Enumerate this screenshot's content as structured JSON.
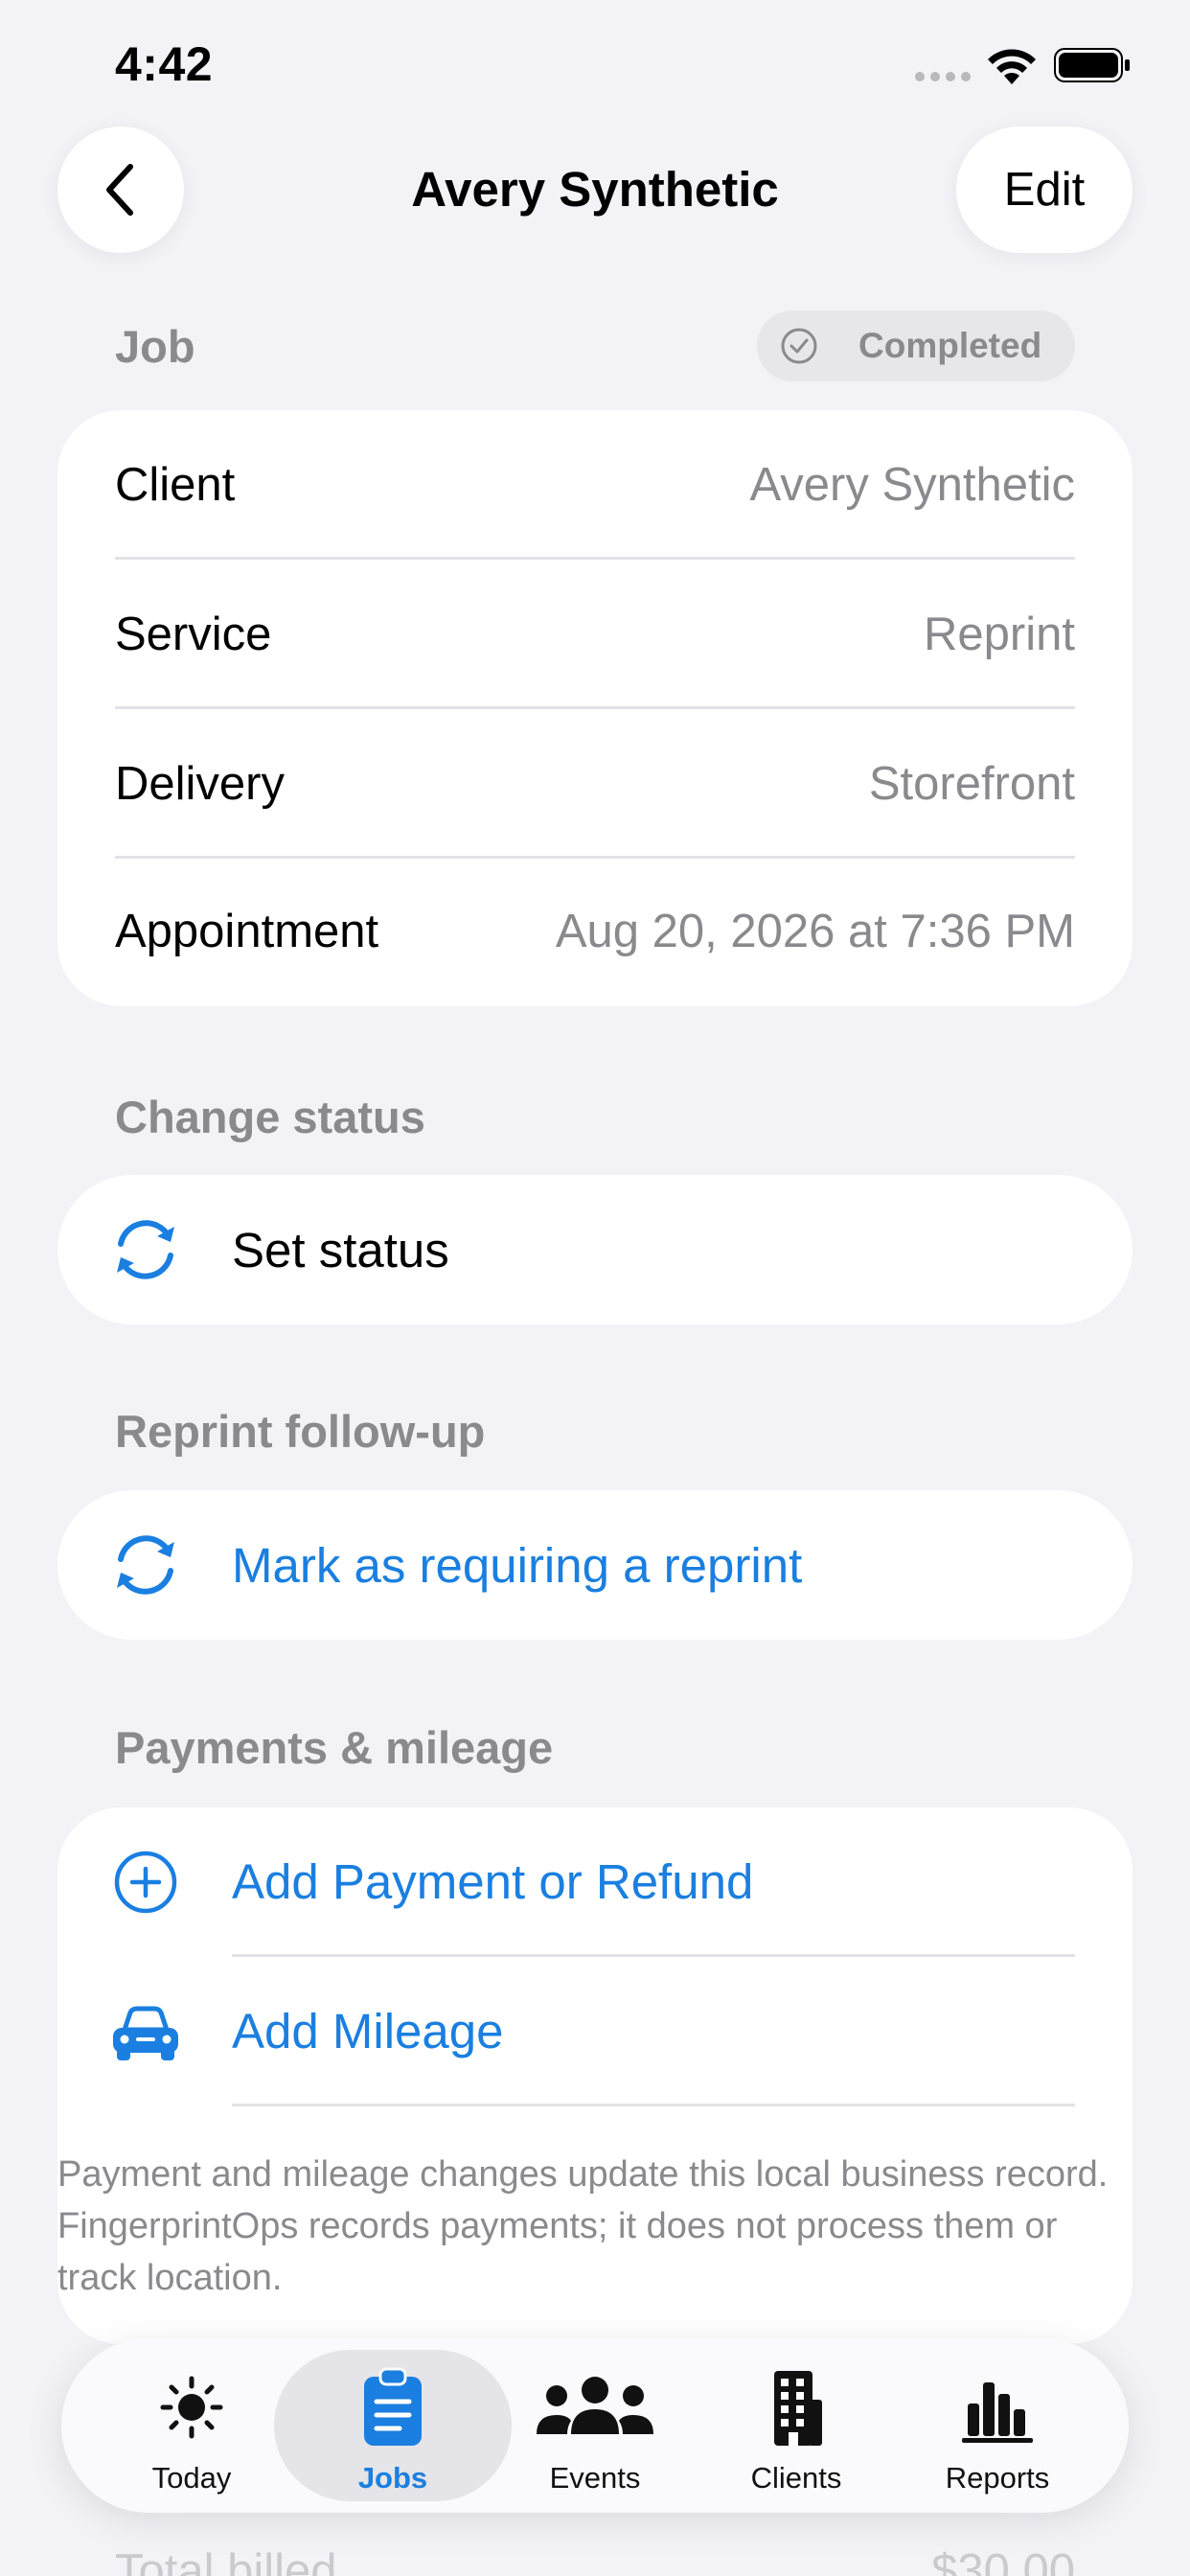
{
  "status_bar": {
    "time": "4:42"
  },
  "nav": {
    "title": "Avery Synthetic",
    "edit_label": "Edit"
  },
  "job": {
    "header": "Job",
    "status_badge": "Completed",
    "rows": [
      {
        "key": "Client",
        "value": "Avery Synthetic"
      },
      {
        "key": "Service",
        "value": "Reprint"
      },
      {
        "key": "Delivery",
        "value": "Storefront"
      },
      {
        "key": "Appointment",
        "value": "Aug 20, 2026 at 7:36 PM"
      }
    ]
  },
  "change_status": {
    "header": "Change status",
    "action_label": "Set status"
  },
  "reprint": {
    "header": "Reprint follow-up",
    "action_label": "Mark as requiring a reprint"
  },
  "payments": {
    "header": "Payments & mileage",
    "add_payment_label": "Add Payment or Refund",
    "add_mileage_label": "Add Mileage",
    "note": "Payment and mileage changes update this local business record. FingerprintOps records payments; it does not process them or track location."
  },
  "faded_summary": {
    "label": "Total billed",
    "value": "$30.00"
  },
  "tabs": [
    {
      "label": "Today",
      "icon": "sun-icon",
      "active": false
    },
    {
      "label": "Jobs",
      "icon": "clipboard-icon",
      "active": true
    },
    {
      "label": "Events",
      "icon": "people-icon",
      "active": false
    },
    {
      "label": "Clients",
      "icon": "building-icon",
      "active": false
    },
    {
      "label": "Reports",
      "icon": "bar-chart-icon",
      "active": false
    }
  ],
  "colors": {
    "accent": "#1a7fe0",
    "background": "#f2f2f7",
    "secondary_text": "#8a8a8e"
  }
}
